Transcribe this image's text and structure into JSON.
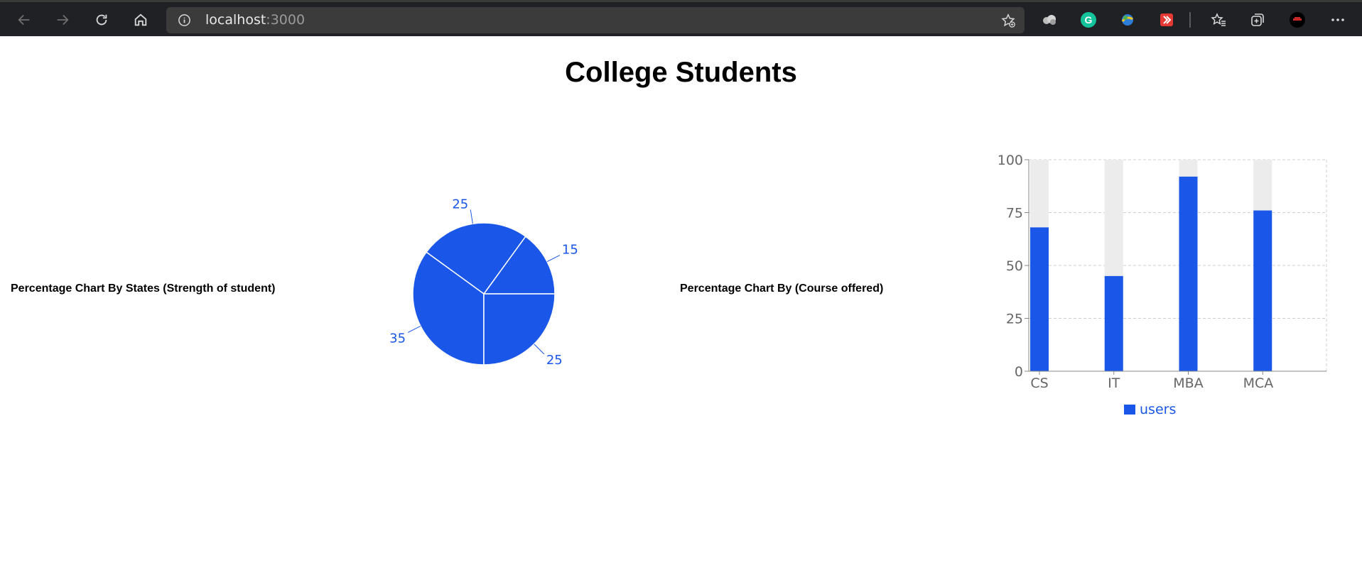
{
  "browser": {
    "url_host": "localhost",
    "url_port": ":3000",
    "nav_icons": [
      "back-icon",
      "forward-icon",
      "reload-icon",
      "home-icon"
    ],
    "extension_icons": [
      "cloud-extension-icon",
      "grammarly-icon",
      "globe-extension-icon",
      "red-extension-icon",
      "favorites-icon",
      "collections-icon",
      "profile-avatar-icon",
      "more-icon"
    ]
  },
  "page": {
    "title": "College Students",
    "pie_label": "Percentage Chart By States (Strength of student)",
    "bar_label": "Percentage Chart By (Course offered)"
  },
  "colors": {
    "accent": "#1a56e8",
    "bar_background": "#ececec",
    "browser_bg": "#202124"
  },
  "chart_data": [
    {
      "type": "pie",
      "values": [
        15,
        25,
        35,
        25
      ],
      "data_labels": [
        "15",
        "25",
        "35",
        "25"
      ],
      "title": ""
    },
    {
      "type": "bar",
      "categories": [
        "CS",
        "IT",
        "MBA",
        "MCA"
      ],
      "series": [
        {
          "name": "users",
          "values": [
            68,
            45,
            92,
            76
          ]
        }
      ],
      "background_max": 100,
      "ylim": [
        0,
        100
      ],
      "yticks": [
        0,
        25,
        50,
        75,
        100
      ],
      "grid": true,
      "legend": "bottom",
      "title": ""
    }
  ]
}
